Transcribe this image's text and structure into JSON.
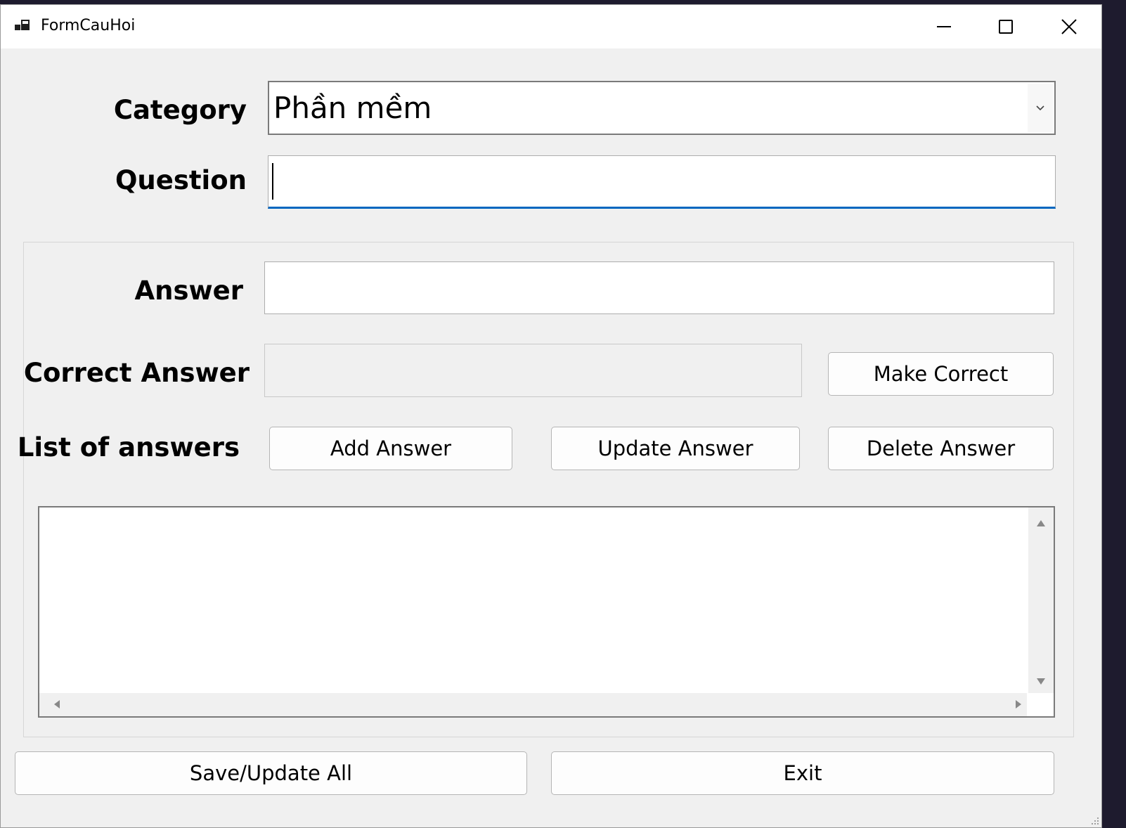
{
  "window": {
    "title": "FormCauHoi"
  },
  "form": {
    "category_label": "Category",
    "category_value": "Phần mềm",
    "question_label": "Question",
    "question_value": "",
    "answer_label": "Answer",
    "answer_value": "",
    "correct_answer_label": "Correct Answer",
    "correct_answer_value": "",
    "list_label": "List of answers"
  },
  "buttons": {
    "make_correct": "Make Correct",
    "add_answer": "Add Answer",
    "update_answer": "Update Answer",
    "delete_answer": "Delete Answer",
    "save_update_all": "Save/Update All",
    "exit": "Exit"
  },
  "answers_list": [],
  "colors": {
    "focus_underline": "#0067c0",
    "form_background": "#f0f0f0"
  }
}
